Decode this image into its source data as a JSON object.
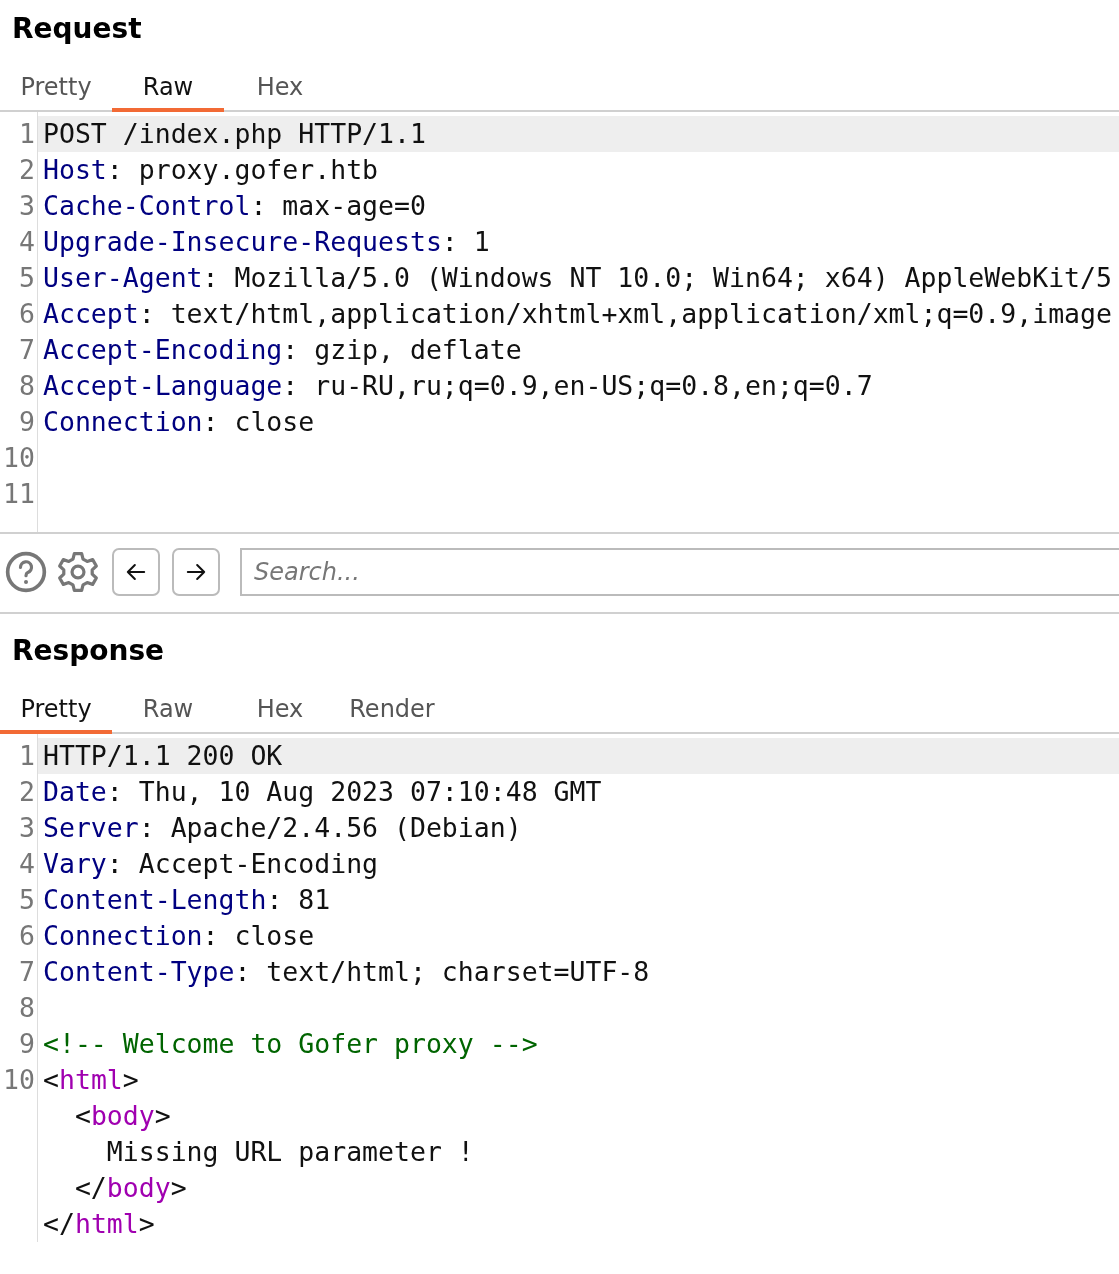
{
  "request": {
    "title": "Request",
    "tabs": [
      {
        "label": "Pretty",
        "selected": false
      },
      {
        "label": "Raw",
        "selected": true
      },
      {
        "label": "Hex",
        "selected": false
      }
    ],
    "lines": [
      {
        "number": "1",
        "current": true,
        "segments": [
          {
            "kind": "text",
            "text": "POST /index.php HTTP/1.1"
          }
        ]
      },
      {
        "number": "2",
        "current": false,
        "segments": [
          {
            "kind": "name",
            "text": "Host"
          },
          {
            "kind": "text",
            "text": ": proxy.gofer.htb"
          }
        ]
      },
      {
        "number": "3",
        "current": false,
        "segments": [
          {
            "kind": "name",
            "text": "Cache-Control"
          },
          {
            "kind": "text",
            "text": ": max-age=0"
          }
        ]
      },
      {
        "number": "4",
        "current": false,
        "segments": [
          {
            "kind": "name",
            "text": "Upgrade-Insecure-Requests"
          },
          {
            "kind": "text",
            "text": ": 1"
          }
        ]
      },
      {
        "number": "5",
        "current": false,
        "segments": [
          {
            "kind": "name",
            "text": "User-Agent"
          },
          {
            "kind": "text",
            "text": ": Mozilla/5.0 (Windows NT 10.0; Win64; x64) AppleWebKit/5"
          }
        ]
      },
      {
        "number": "6",
        "current": false,
        "segments": [
          {
            "kind": "name",
            "text": "Accept"
          },
          {
            "kind": "text",
            "text": ": text/html,application/xhtml+xml,application/xml;q=0.9,image"
          }
        ]
      },
      {
        "number": "7",
        "current": false,
        "segments": [
          {
            "kind": "name",
            "text": "Accept-Encoding"
          },
          {
            "kind": "text",
            "text": ": gzip, deflate"
          }
        ]
      },
      {
        "number": "8",
        "current": false,
        "segments": [
          {
            "kind": "name",
            "text": "Accept-Language"
          },
          {
            "kind": "text",
            "text": ": ru-RU,ru;q=0.9,en-US;q=0.8,en;q=0.7"
          }
        ]
      },
      {
        "number": "9",
        "current": false,
        "segments": [
          {
            "kind": "name",
            "text": "Connection"
          },
          {
            "kind": "text",
            "text": ": close"
          }
        ]
      },
      {
        "number": "10",
        "current": false
      },
      {
        "number": "11",
        "current": false
      }
    ]
  },
  "toolbar": {
    "search": {
      "placeholder": "Search..."
    }
  },
  "response": {
    "title": "Response",
    "tabs": [
      {
        "label": "Pretty",
        "selected": true
      },
      {
        "label": "Raw",
        "selected": false
      },
      {
        "label": "Hex",
        "selected": false
      },
      {
        "label": "Render",
        "selected": false
      }
    ],
    "lines": [
      {
        "number": "1",
        "current": true,
        "segments": [
          {
            "kind": "text",
            "text": "HTTP/1.1 200 OK"
          }
        ]
      },
      {
        "number": "2",
        "current": false,
        "segments": [
          {
            "kind": "name",
            "text": "Date"
          },
          {
            "kind": "text",
            "text": ": Thu, 10 Aug 2023 07:10:48 GMT"
          }
        ]
      },
      {
        "number": "3",
        "current": false,
        "segments": [
          {
            "kind": "name",
            "text": "Server"
          },
          {
            "kind": "text",
            "text": ": Apache/2.4.56 (Debian)"
          }
        ]
      },
      {
        "number": "4",
        "current": false,
        "segments": [
          {
            "kind": "name",
            "text": "Vary"
          },
          {
            "kind": "text",
            "text": ": Accept-Encoding"
          }
        ]
      },
      {
        "number": "5",
        "current": false,
        "segments": [
          {
            "kind": "name",
            "text": "Content-Length"
          },
          {
            "kind": "text",
            "text": ": 81"
          }
        ]
      },
      {
        "number": "6",
        "current": false,
        "segments": [
          {
            "kind": "name",
            "text": "Connection"
          },
          {
            "kind": "text",
            "text": ": close"
          }
        ]
      },
      {
        "number": "7",
        "current": false,
        "segments": [
          {
            "kind": "name",
            "text": "Content-Type"
          },
          {
            "kind": "text",
            "text": ": text/html; charset=UTF-8"
          }
        ]
      },
      {
        "number": "8",
        "current": false
      },
      {
        "number": "9",
        "current": false,
        "segments": [
          {
            "kind": "comment",
            "text": "<!-- Welcome to Gofer proxy -->"
          }
        ]
      },
      {
        "number": "10",
        "current": false,
        "segments": [
          {
            "kind": "text",
            "text": "<"
          },
          {
            "kind": "tag",
            "text": "html"
          },
          {
            "kind": "text",
            "text": ">"
          }
        ],
        "children": [
          {
            "current": false,
            "segments": [
              {
                "kind": "text",
                "text": "<"
              },
              {
                "kind": "tag",
                "text": "body"
              },
              {
                "kind": "text",
                "text": ">"
              }
            ],
            "children": [
              {
                "current": false,
                "segments": [
                  {
                    "kind": "text",
                    "text": "Missing URL parameter !"
                  }
                ]
              }
            ]
          },
          {
            "current": false,
            "segments": [
              {
                "kind": "text",
                "text": "</"
              },
              {
                "kind": "tag",
                "text": "body"
              },
              {
                "kind": "text",
                "text": ">"
              }
            ]
          }
        ]
      },
      {
        "current": false,
        "segments": [
          {
            "kind": "text",
            "text": "</"
          },
          {
            "kind": "tag",
            "text": "html"
          },
          {
            "kind": "text",
            "text": ">"
          }
        ]
      }
    ]
  }
}
